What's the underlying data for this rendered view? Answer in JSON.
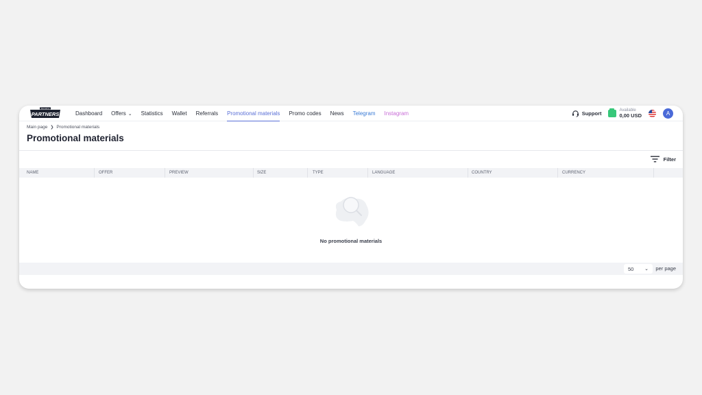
{
  "brand": {
    "logo_text": "PARTNERS",
    "logo_tagline": "Earn with us"
  },
  "nav": {
    "items": [
      {
        "label": "Dashboard"
      },
      {
        "label": "Offers"
      },
      {
        "label": "Statistics"
      },
      {
        "label": "Wallet"
      },
      {
        "label": "Referrals"
      },
      {
        "label": "Promotional materials"
      },
      {
        "label": "Promo codes"
      },
      {
        "label": "News"
      },
      {
        "label": "Telegram"
      },
      {
        "label": "Instagram"
      }
    ],
    "active": "Promotional materials"
  },
  "header": {
    "support_label": "Support",
    "balance_label": "Available",
    "balance_value": "0,00 USD",
    "avatar_letter": "A"
  },
  "breadcrumb": {
    "home": "Main page",
    "current": "Promotional materials"
  },
  "page": {
    "title": "Promotional materials"
  },
  "toolbar": {
    "filter_label": "Filter"
  },
  "table": {
    "columns": [
      "NAME",
      "OFFER",
      "PREVIEW",
      "SIZE",
      "TYPE",
      "LANGUAGE",
      "COUNTRY",
      "CURRENCY"
    ],
    "empty_text": "No promotional materials"
  },
  "pagination": {
    "per_page_value": "50",
    "per_page_label": "per page"
  },
  "colors": {
    "accent": "#5a6fd6",
    "telegram": "#3a7bd5",
    "instagram": "#c86dd7",
    "wallet": "#37c779",
    "avatar": "#4a6ad8"
  }
}
